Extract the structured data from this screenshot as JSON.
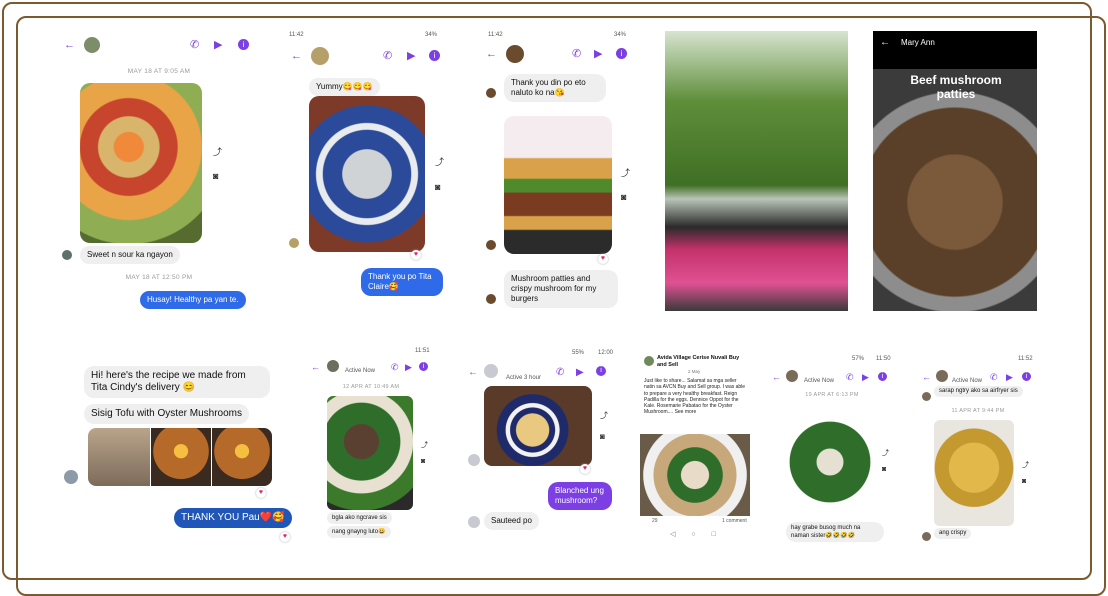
{
  "colors": {
    "frame": "#7a5a2e",
    "messenger_accent": "#7b3fe4",
    "sent_bubble": "#2f6be8",
    "received_bubble": "#efefef"
  },
  "icons": [
    "back-arrow-icon",
    "phone-icon",
    "video-icon",
    "info-icon",
    "share-icon",
    "camera-icon",
    "heart-reaction-icon"
  ],
  "chat1": {
    "stamp1": "MAY 18 AT 9:05 AM",
    "caption": "Sweet n sour ka ngayon",
    "stamp2": "MAY 18 AT 12:50 PM",
    "reply": "Husay! Healthy pa yan te."
  },
  "chat2": {
    "status_time": "11:42",
    "status_batt": "34%",
    "msg1": "Yummy😋😋😋",
    "reply": "Thank you po Tita Claire🥰"
  },
  "chat3": {
    "status_time": "11:42",
    "status_batt": "34%",
    "msg1": "Thank you din po eto naluto ko na😘",
    "msg2": "Mushroom patties and crispy mushroom for my burgers"
  },
  "story": {
    "name": "Mary Ann",
    "title": "Beef mushroom patties"
  },
  "chat5": {
    "msg1": "Hi! here's the recipe we made from Tita Cindy's delivery 😊",
    "msg2": "Sisig Tofu with Oyster Mushrooms",
    "reply": "THANK YOU Pau❤️🥰"
  },
  "chat6": {
    "status_time": "11:51",
    "active": "Active Now",
    "stamp": "12 APR AT 10:49 AM",
    "msg1": "bgla ako ngcrave sis",
    "msg2": "nang gnayng luto😀"
  },
  "chat7": {
    "status_time": "12:00",
    "status_batt": "55%",
    "active": "Active 3 hour",
    "reply": "Blanched ung mushroom?",
    "msg": "Sauteed po"
  },
  "post": {
    "group": "Avida Village Cerise Nuvali Buy and Sell",
    "time": "2 May",
    "body": "Just like to share... Salamat sa mga seller natin sa AVCN Buy and Sell group. I was able to prepare a very healthy breakfast. Reign Padilla for the eggs. Dennice Oppot for the Kale. Rosemarie Pabatao for the Oyster Mushroom.... See more",
    "reactions": "29",
    "comments": "1 comment"
  },
  "chat9": {
    "status_time": "11:50",
    "status_batt": "57%",
    "active": "Active Now",
    "stamp": "19 APR AT 6:13 PM",
    "msg": "hay grabe busog much na naman sister🤣🤣🤣🤣"
  },
  "chat10": {
    "status_time": "11:52",
    "active": "Active Now",
    "msg1": "sarap ngtry ako sa airfryer sis",
    "stamp": "11 APR AT 9:44 PM",
    "msg2": "ang crispy"
  }
}
